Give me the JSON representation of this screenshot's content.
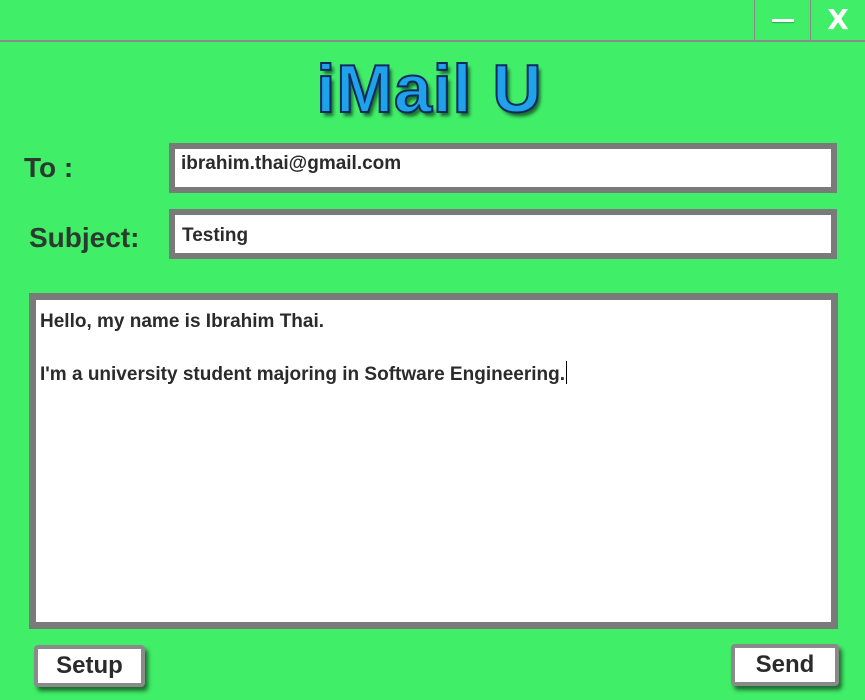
{
  "window": {
    "minimize_icon": "minimize-icon",
    "close_label": "X"
  },
  "logo": {
    "text": "iMail U",
    "colors": {
      "fill": "#1FA2EA",
      "outline": "#0B2B5A"
    }
  },
  "form": {
    "to_label": "To :",
    "to_value": "ibrahim.thai@gmail.com",
    "subject_label": "Subject:",
    "subject_value": "Testing",
    "body_lines": [
      "Hello, my name is Ibrahim Thai.",
      "",
      "I'm a university student majoring in Software Engineering."
    ]
  },
  "actions": {
    "setup_label": "Setup",
    "send_label": "Send"
  },
  "colors": {
    "background": "#40EE68",
    "field_border": "#7A7A7A",
    "label_text": "#2B3A2E"
  }
}
